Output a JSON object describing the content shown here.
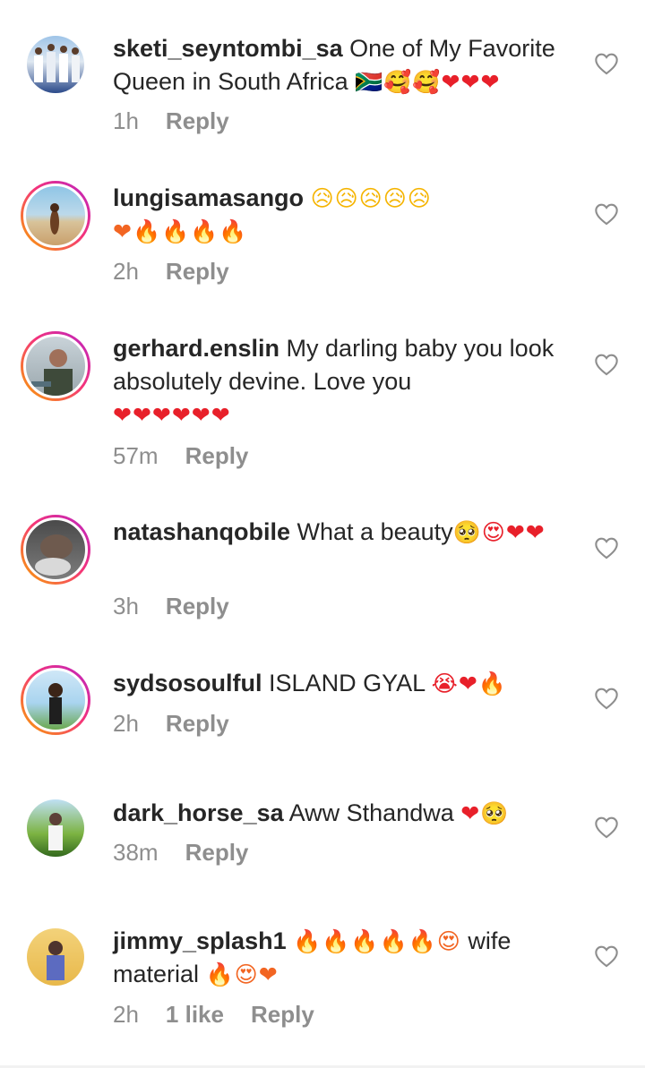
{
  "comments": [
    {
      "user": "sketi_seyntombi_sa",
      "text": " One of My Favorite Queen in South Africa ",
      "emoji": "🇿🇦🥰🥰❤❤❤",
      "time": "1h",
      "reply": "Reply"
    },
    {
      "user": "lungisamasango",
      "text": " ",
      "emoji": "😥😥😥😥😥",
      "emoji2": "❤🔥🔥🔥🔥",
      "time": "2h",
      "reply": "Reply"
    },
    {
      "user": "gerhard.enslin",
      "text": " My darling baby you look absolutely devine. Love you",
      "emoji": "❤❤❤❤❤❤",
      "time": "57m",
      "reply": "Reply"
    },
    {
      "user": "natashanqobile",
      "text": " What a beauty",
      "emoji": "🥺😍❤❤",
      "time": "3h",
      "reply": "Reply"
    },
    {
      "user": "sydsosoulful",
      "text": " ISLAND GYAL ",
      "emoji": "😭❤🔥",
      "time": "2h",
      "reply": "Reply"
    },
    {
      "user": "dark_horse_sa",
      "text": " Aww Sthandwa ",
      "emoji": "❤🥺",
      "time": "38m",
      "reply": "Reply"
    },
    {
      "user": "jimmy_splash1",
      "text": " ",
      "emoji": "🔥🔥🔥🔥🔥😍",
      "text2": " wife material ",
      "emoji2": "🔥😍❤",
      "time": "2h",
      "likes": "1 like",
      "reply": "Reply"
    }
  ],
  "icons": {
    "heart": "heart-outline-icon"
  },
  "colors": {
    "text": "#262626",
    "meta": "#8e8e8e",
    "ring": "#f4337a"
  }
}
